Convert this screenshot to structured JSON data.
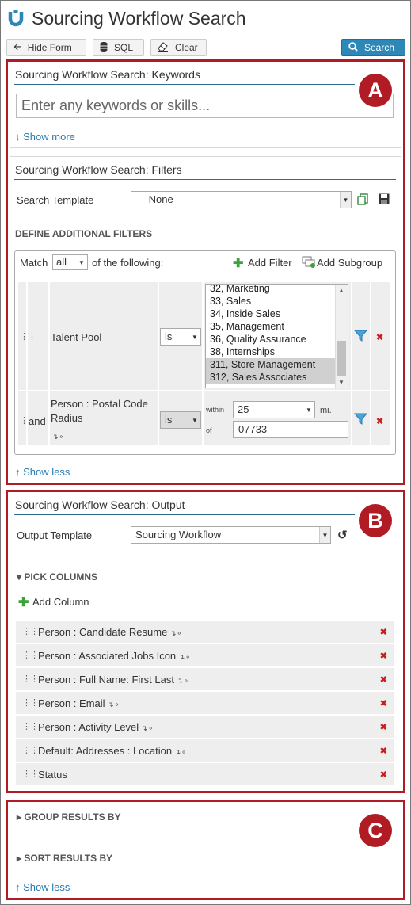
{
  "header": {
    "title": "Sourcing Workflow Search"
  },
  "toolbar": {
    "hide_form": "Hide Form",
    "sql": "SQL",
    "clear": "Clear",
    "search": "Search"
  },
  "annotations": {
    "a": "A",
    "b": "B",
    "c": "C"
  },
  "keywords": {
    "title": "Sourcing Workflow Search: Keywords",
    "placeholder": "Enter any keywords or skills...",
    "show_more": "Show more"
  },
  "filters": {
    "title": "Sourcing Workflow Search: Filters",
    "template_label": "Search Template",
    "template_value": "— None —",
    "define_heading": "DEFINE ADDITIONAL FILTERS",
    "match_prefix": "Match",
    "match_value": "all",
    "match_suffix": "of the following:",
    "add_filter": "Add Filter",
    "add_subgroup": "Add Subgroup",
    "row1": {
      "field": "Talent Pool",
      "operator": "is",
      "options": [
        {
          "text": "32, Marketing",
          "selected": false
        },
        {
          "text": "33, Sales",
          "selected": false
        },
        {
          "text": "34, Inside Sales",
          "selected": false
        },
        {
          "text": "35, Management",
          "selected": false
        },
        {
          "text": "36, Quality Assurance",
          "selected": false
        },
        {
          "text": "38, Internships",
          "selected": false
        },
        {
          "text": "311, Store Management",
          "selected": true
        },
        {
          "text": "312, Sales Associates",
          "selected": true
        }
      ]
    },
    "row2": {
      "conjunction": "and",
      "field_line1": "Person : Postal Code",
      "field_line2": "Radius",
      "operator": "is",
      "within_label": "within",
      "within_value": "25",
      "unit": "mi.",
      "of_label": "of",
      "postal_code": "07733"
    },
    "show_less": "Show less"
  },
  "output": {
    "title": "Sourcing Workflow Search: Output",
    "template_label": "Output Template",
    "template_value": "Sourcing Workflow",
    "pick_columns": "PICK COLUMNS",
    "add_column": "Add Column",
    "columns": [
      {
        "name": "Person : Candidate Resume",
        "has_link_icon": true
      },
      {
        "name": "Person : Associated Jobs Icon",
        "has_link_icon": true
      },
      {
        "name": "Person : Full Name: First Last",
        "has_link_icon": true
      },
      {
        "name": "Person : Email",
        "has_link_icon": true
      },
      {
        "name": "Person : Activity Level",
        "has_link_icon": true
      },
      {
        "name": "Default: Addresses : Location",
        "has_link_icon": true
      },
      {
        "name": "Status",
        "has_link_icon": false
      }
    ]
  },
  "group": {
    "group_by": "GROUP RESULTS BY",
    "sort_by": "SORT RESULTS BY",
    "show_less": "Show less"
  },
  "colors": {
    "annotation_red": "#b11c24",
    "accent_blue": "#2d88b8",
    "link_blue": "#2a7ab0",
    "delete_red": "#c81e1e"
  },
  "icons": [
    "logo-icon",
    "arrow-left-icon",
    "database-icon",
    "eraser-icon",
    "search-icon",
    "copy-icon",
    "save-icon",
    "plus-icon",
    "add-subgroup-icon",
    "drag-handle-icon",
    "filter-funnel-icon",
    "delete-x-icon",
    "reset-icon",
    "link-icon"
  ]
}
